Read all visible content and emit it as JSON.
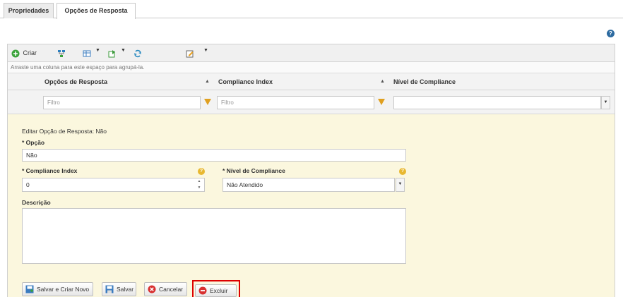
{
  "tabs": [
    {
      "label": "Propriedades"
    },
    {
      "label": "Opções de Resposta"
    }
  ],
  "toolbar": {
    "criar_label": "Criar"
  },
  "group_hint": "Arraste uma coluna para este espaço para agrupá-la.",
  "columns": [
    {
      "label": "Opções de Resposta"
    },
    {
      "label": "Compliance Index"
    },
    {
      "label": "Nível de Compliance"
    }
  ],
  "filter": {
    "placeholder_1": "Filtro",
    "placeholder_2": "Filtro"
  },
  "edit": {
    "title": "Editar Opção de Resposta: Não",
    "opcao_label": "* Opção",
    "opcao_value": "Não",
    "compliance_index_label": "* Compliance Index",
    "compliance_index_value": "0",
    "nivel_label": "* Nível de Compliance",
    "nivel_value": "Não Atendido",
    "descricao_label": "Descrição",
    "descricao_value": ""
  },
  "buttons": {
    "salvar_criar_novo": "Salvar e Criar Novo",
    "salvar": "Salvar",
    "cancelar": "Cancelar",
    "excluir": "Excluir"
  },
  "icons": {
    "help": "?",
    "sort_asc": "▲",
    "dropdown": "▼"
  },
  "colors": {
    "edit_background": "#fbf7de",
    "highlight_border": "#dd0000"
  }
}
